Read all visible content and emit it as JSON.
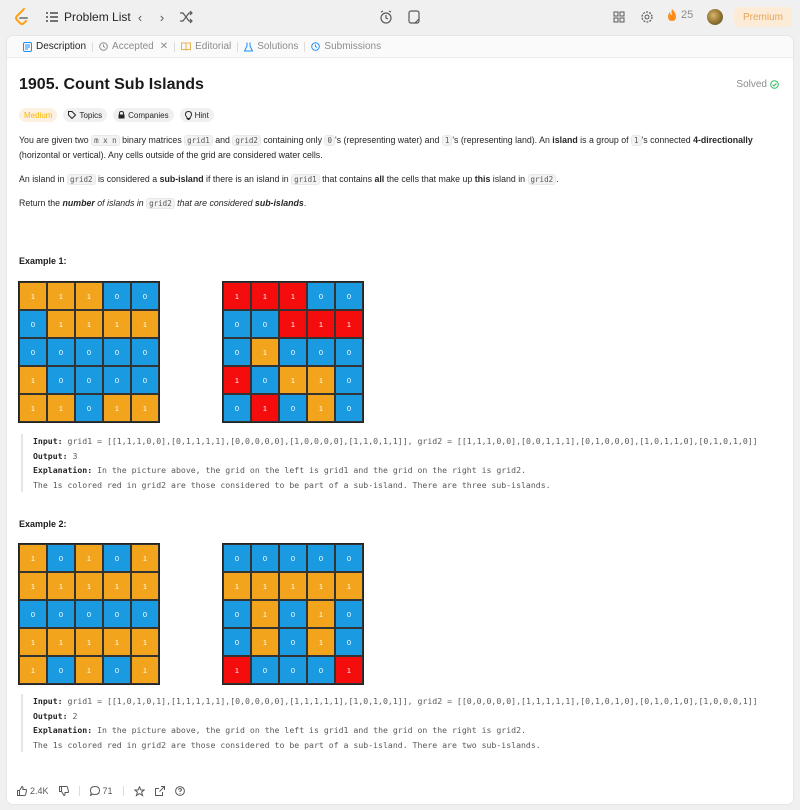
{
  "topbar": {
    "problem_list": "Problem List",
    "streak": "25",
    "premium": "Premium",
    "colors": {
      "accent": "#ffa116",
      "fire": "#ff8c1a"
    }
  },
  "tabs": [
    {
      "label": "Description",
      "icon": "description-icon"
    },
    {
      "label": "Accepted",
      "icon": "history-icon"
    },
    {
      "label": "Editorial",
      "icon": "book-icon"
    },
    {
      "label": "Solutions",
      "icon": "flask-icon"
    },
    {
      "label": "Submissions",
      "icon": "history-icon"
    }
  ],
  "problem": {
    "title": "1905. Count Sub Islands",
    "status": "Solved",
    "difficulty": "Medium",
    "topics": "Topics",
    "companies": "Companies",
    "hint": "Hint"
  },
  "example1": {
    "heading": "Example 1:",
    "grid1": [
      [
        1,
        1,
        1,
        0,
        0
      ],
      [
        0,
        1,
        1,
        1,
        1
      ],
      [
        0,
        0,
        0,
        0,
        0
      ],
      [
        1,
        0,
        0,
        0,
        0
      ],
      [
        1,
        1,
        0,
        1,
        1
      ]
    ],
    "grid2": [
      [
        1,
        1,
        1,
        0,
        0
      ],
      [
        0,
        0,
        1,
        1,
        1
      ],
      [
        0,
        1,
        0,
        0,
        0
      ],
      [
        1,
        0,
        1,
        1,
        0
      ],
      [
        0,
        1,
        0,
        1,
        0
      ]
    ],
    "grid2_colors": [
      [
        "r",
        "r",
        "r",
        "b",
        "b"
      ],
      [
        "b",
        "b",
        "r",
        "r",
        "r"
      ],
      [
        "b",
        "o",
        "b",
        "b",
        "b"
      ],
      [
        "r",
        "b",
        "o",
        "o",
        "b"
      ],
      [
        "b",
        "r",
        "b",
        "o",
        "b"
      ]
    ],
    "input_label": "Input:",
    "input": "grid1 = [[1,1,1,0,0],[0,1,1,1,1],[0,0,0,0,0],[1,0,0,0,0],[1,1,0,1,1]], grid2 = [[1,1,1,0,0],[0,0,1,1,1],[0,1,0,0,0],[1,0,1,1,0],[0,1,0,1,0]]",
    "output_label": "Output:",
    "output": "3",
    "explanation_label": "Explanation:",
    "explanation": "In the picture above, the grid on the left is grid1 and the grid on the right is grid2.\nThe 1s colored red in grid2 are those considered to be part of a sub-island. There are three sub-islands."
  },
  "example2": {
    "heading": "Example 2:",
    "grid1": [
      [
        1,
        0,
        1,
        0,
        1
      ],
      [
        1,
        1,
        1,
        1,
        1
      ],
      [
        0,
        0,
        0,
        0,
        0
      ],
      [
        1,
        1,
        1,
        1,
        1
      ],
      [
        1,
        0,
        1,
        0,
        1
      ]
    ],
    "grid2": [
      [
        0,
        0,
        0,
        0,
        0
      ],
      [
        1,
        1,
        1,
        1,
        1
      ],
      [
        0,
        1,
        0,
        1,
        0
      ],
      [
        0,
        1,
        0,
        1,
        0
      ],
      [
        1,
        0,
        0,
        0,
        1
      ]
    ],
    "grid2_colors": [
      [
        "b",
        "b",
        "b",
        "b",
        "b"
      ],
      [
        "o",
        "o",
        "o",
        "o",
        "o"
      ],
      [
        "b",
        "o",
        "b",
        "o",
        "b"
      ],
      [
        "b",
        "o",
        "b",
        "o",
        "b"
      ],
      [
        "r",
        "b",
        "b",
        "b",
        "r"
      ]
    ],
    "input_label": "Input:",
    "input": "grid1 = [[1,0,1,0,1],[1,1,1,1,1],[0,0,0,0,0],[1,1,1,1,1],[1,0,1,0,1]], grid2 = [[0,0,0,0,0],[1,1,1,1,1],[0,1,0,1,0],[0,1,0,1,0],[1,0,0,0,1]]",
    "output_label": "Output:",
    "output": "2",
    "explanation_label": "Explanation:",
    "explanation": "In the picture above, the grid on the left is grid1 and the grid on the right is grid2.\nThe 1s colored red in grid2 are those considered to be part of a sub-island. There are two sub-islands."
  },
  "cell_colors": {
    "land": "#f2a41c",
    "water": "#1a9ae0",
    "sub": "#f50d0d"
  },
  "footer": {
    "likes": "2.4K",
    "comments": "71"
  }
}
